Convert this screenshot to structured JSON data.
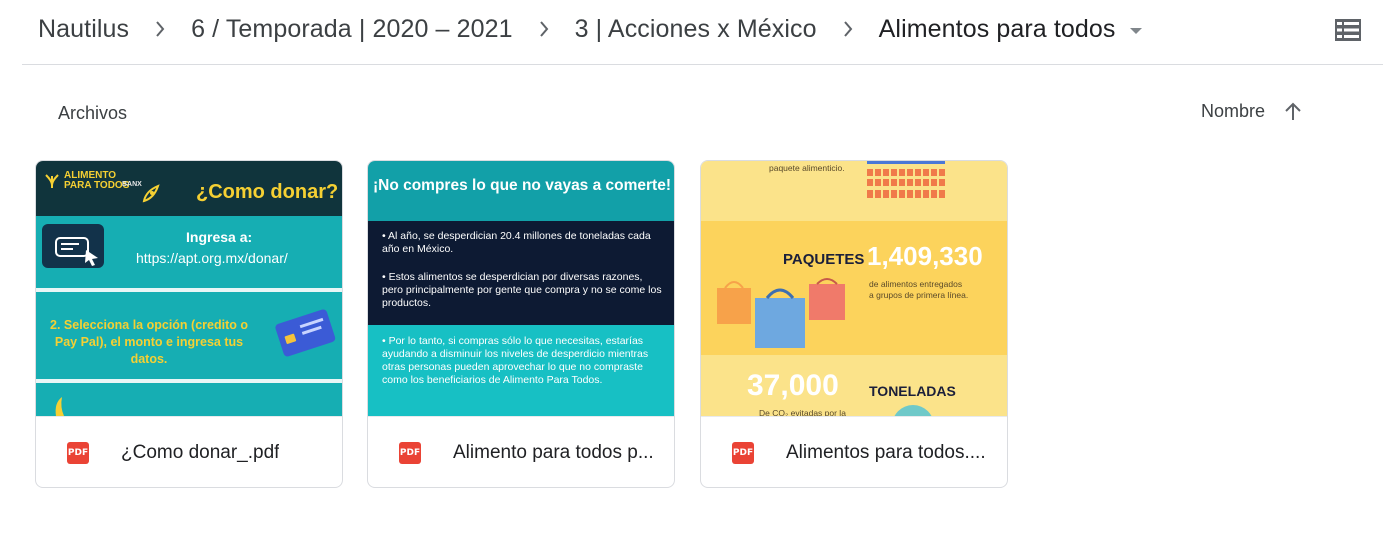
{
  "breadcrumb": {
    "items": [
      "Nautilus",
      "6 / Temporada | 2020 – 2021",
      "3 | Acciones x México",
      "Alimentos para todos"
    ]
  },
  "section": {
    "title": "Archivos"
  },
  "sort": {
    "label": "Nombre"
  },
  "files": [
    {
      "name": "¿Como donar_.pdf",
      "type": "PDF",
      "thumb": {
        "brand_line1": "ALIMENTO",
        "brand_line2": "PARA TODOS",
        "brand_partner": "BANX",
        "title": "¿Como donar?",
        "ingresa": "Ingresa a:",
        "url": "https://apt.org.mx/donar/",
        "step": "2. Selecciona la opción (credito o Pay Pal), el monto e ingresa tus datos."
      }
    },
    {
      "name": "Alimento para todos p...",
      "type": "PDF",
      "thumb": {
        "title": "¡No compres lo que no vayas a comerte!",
        "p1": "• Al año, se desperdician 20.4 millones de toneladas cada año en México.",
        "p2": "• Estos alimentos se desperdician por diversas razones, pero principalmente por gente que compra y no se come los productos.",
        "p3": "• Por lo tanto, si compras sólo lo que necesitas, estarías ayudando a disminuir los niveles de desperdicio mientras otras personas pueden aprovechar lo que no compraste como los beneficiarios de Alimento Para Todos."
      }
    },
    {
      "name": "Alimentos para todos....",
      "type": "PDF",
      "thumb": {
        "top_text": "paquete alimenticio.",
        "paquetes_label": "PAQUETES",
        "paquetes_value": "1,409,330",
        "paquetes_desc": "de alimentos entregados a grupos de primera línea.",
        "toneladas_value": "37,000",
        "toneladas_label": "TONELADAS",
        "toneladas_desc": "De CO₂ evitadas por la"
      }
    }
  ],
  "colors": {
    "pdf_red": "#ea4335",
    "divider": "#dadce0"
  }
}
